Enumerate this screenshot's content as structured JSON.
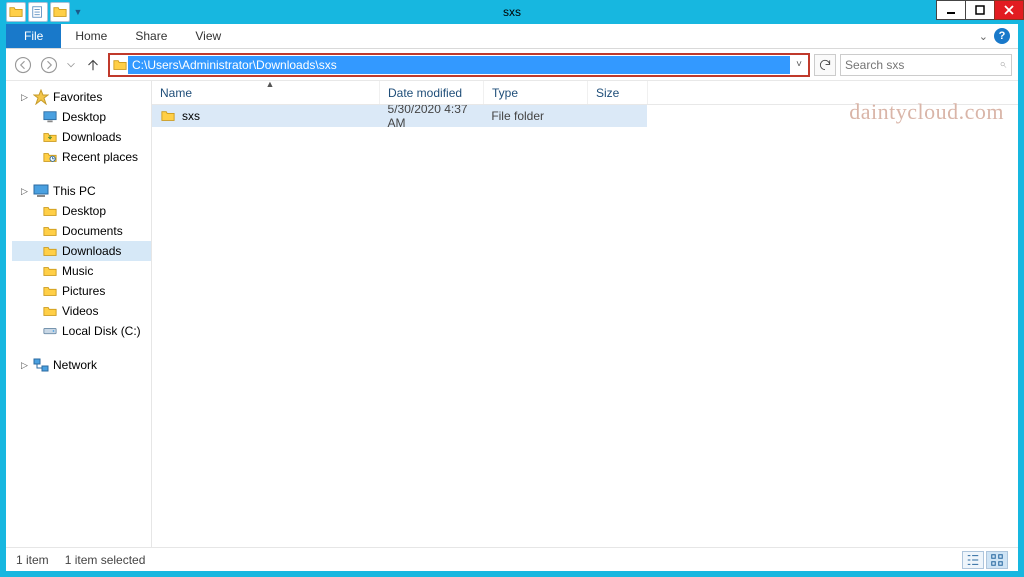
{
  "window": {
    "title": "sxs"
  },
  "ribbon": {
    "file": "File",
    "tabs": [
      "Home",
      "Share",
      "View"
    ]
  },
  "address": {
    "path": "C:\\Users\\Administrator\\Downloads\\sxs"
  },
  "search": {
    "placeholder": "Search sxs"
  },
  "sidebar": {
    "favorites": {
      "label": "Favorites",
      "items": [
        {
          "label": "Desktop",
          "icon": "desktop"
        },
        {
          "label": "Downloads",
          "icon": "downloads",
          "selected": false
        },
        {
          "label": "Recent places",
          "icon": "recent"
        }
      ]
    },
    "thispc": {
      "label": "This PC",
      "items": [
        {
          "label": "Desktop",
          "icon": "desktop"
        },
        {
          "label": "Documents",
          "icon": "folder-doc"
        },
        {
          "label": "Downloads",
          "icon": "folder-dl",
          "selected": true
        },
        {
          "label": "Music",
          "icon": "folder-music"
        },
        {
          "label": "Pictures",
          "icon": "folder-pic"
        },
        {
          "label": "Videos",
          "icon": "folder-vid"
        },
        {
          "label": "Local Disk (C:)",
          "icon": "disk"
        }
      ]
    },
    "network": {
      "label": "Network"
    }
  },
  "columns": {
    "name": "Name",
    "date": "Date modified",
    "type": "Type",
    "size": "Size"
  },
  "rows": [
    {
      "name": "sxs",
      "date": "5/30/2020 4:37 AM",
      "type": "File folder",
      "size": ""
    }
  ],
  "status": {
    "count": "1 item",
    "selected": "1 item selected"
  },
  "watermark": "daintycloud.com"
}
